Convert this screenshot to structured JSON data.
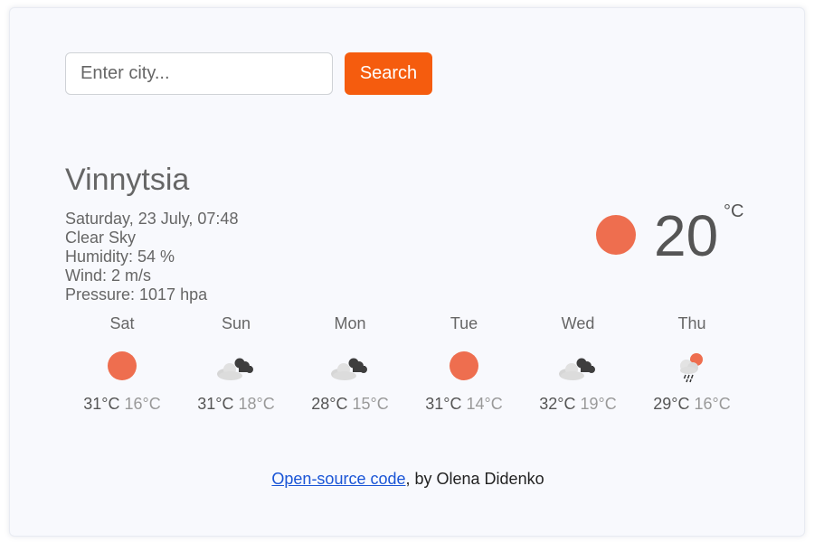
{
  "search": {
    "placeholder": "Enter city...",
    "value": "",
    "button_label": "Search"
  },
  "current": {
    "city": "Vinnytsia",
    "datetime": "Saturday, 23 July, 07:48",
    "description": "Clear Sky",
    "humidity": "Humidity: 54 %",
    "wind": "Wind: 2 m/s",
    "pressure": "Pressure: 1017 hpa",
    "temperature": "20",
    "unit": "°C",
    "icon": "sun-icon"
  },
  "forecast": [
    {
      "day": "Sat",
      "max": "31°C",
      "min": "16°C",
      "icon": "sun-icon"
    },
    {
      "day": "Sun",
      "max": "31°C",
      "min": "18°C",
      "icon": "clouds-icon"
    },
    {
      "day": "Mon",
      "max": "28°C",
      "min": "15°C",
      "icon": "clouds-icon"
    },
    {
      "day": "Tue",
      "max": "31°C",
      "min": "14°C",
      "icon": "sun-icon"
    },
    {
      "day": "Wed",
      "max": "32°C",
      "min": "19°C",
      "icon": "clouds-icon"
    },
    {
      "day": "Thu",
      "max": "29°C",
      "min": "16°C",
      "icon": "rain-sun-icon"
    }
  ],
  "footer": {
    "link_text": "Open-source code",
    "suffix": ", by Olena Didenko"
  },
  "colors": {
    "accent": "#f55c0e",
    "sun": "#ee6e4f",
    "link": "#1a55d6"
  }
}
